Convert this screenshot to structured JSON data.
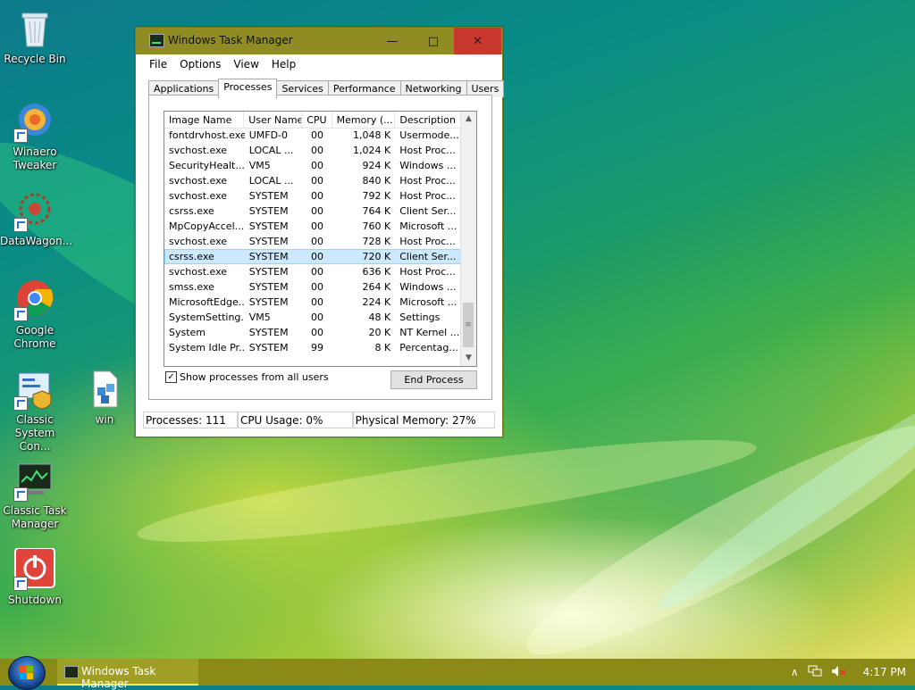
{
  "desktop": {
    "icons": [
      {
        "label": "Recycle Bin"
      },
      {
        "label": "Winaero Tweaker"
      },
      {
        "label": "DataWagon..."
      },
      {
        "label": "Google Chrome"
      },
      {
        "label": "Classic System Con..."
      },
      {
        "label": "win"
      },
      {
        "label": "Classic Task Manager"
      },
      {
        "label": "Shutdown"
      }
    ]
  },
  "window": {
    "title": "Windows Task Manager",
    "controls": {
      "minimize": "—",
      "maximize": "□",
      "close": "✕"
    },
    "menu": [
      "File",
      "Options",
      "View",
      "Help"
    ],
    "tabs": [
      "Applications",
      "Processes",
      "Services",
      "Performance",
      "Networking",
      "Users"
    ],
    "active_tab": "Processes",
    "table": {
      "columns": [
        "Image Name",
        "User Name",
        "CPU",
        "Memory (...",
        "Description"
      ],
      "sort_column": "Memory (...",
      "rows": [
        [
          "fontdrvhost.exe",
          "UMFD-0",
          "00",
          "1,048 K",
          "Usermode..."
        ],
        [
          "svchost.exe",
          "LOCAL ...",
          "00",
          "1,024 K",
          "Host Proc..."
        ],
        [
          "SecurityHealt...",
          "VM5",
          "00",
          "924 K",
          "Windows ..."
        ],
        [
          "svchost.exe",
          "LOCAL ...",
          "00",
          "840 K",
          "Host Proc..."
        ],
        [
          "svchost.exe",
          "SYSTEM",
          "00",
          "792 K",
          "Host Proc..."
        ],
        [
          "csrss.exe",
          "SYSTEM",
          "00",
          "764 K",
          "Client Ser..."
        ],
        [
          "MpCopyAccel...",
          "SYSTEM",
          "00",
          "760 K",
          "Microsoft ..."
        ],
        [
          "svchost.exe",
          "SYSTEM",
          "00",
          "728 K",
          "Host Proc..."
        ],
        [
          "csrss.exe",
          "SYSTEM",
          "00",
          "720 K",
          "Client Ser..."
        ],
        [
          "svchost.exe",
          "SYSTEM",
          "00",
          "636 K",
          "Host Proc..."
        ],
        [
          "smss.exe",
          "SYSTEM",
          "00",
          "264 K",
          "Windows ..."
        ],
        [
          "MicrosoftEdge...",
          "SYSTEM",
          "00",
          "224 K",
          "Microsoft ..."
        ],
        [
          "SystemSetting...",
          "VM5",
          "00",
          "48 K",
          "Settings"
        ],
        [
          "System",
          "SYSTEM",
          "00",
          "20 K",
          "NT Kernel ..."
        ],
        [
          "System Idle Pr...",
          "SYSTEM",
          "99",
          "8 K",
          "Percentag..."
        ]
      ],
      "selected_row": 8
    },
    "show_all_users": {
      "label": "Show processes from all users",
      "checked": true
    },
    "end_process_label": "End Process",
    "status": {
      "processes": "Processes: 111",
      "cpu": "CPU Usage: 0%",
      "memory": "Physical Memory: 27%"
    }
  },
  "taskbar": {
    "items": [
      {
        "label": "Windows Task Manager"
      }
    ],
    "tray": {
      "chevron": "∧",
      "time": "4:17 PM"
    }
  }
}
